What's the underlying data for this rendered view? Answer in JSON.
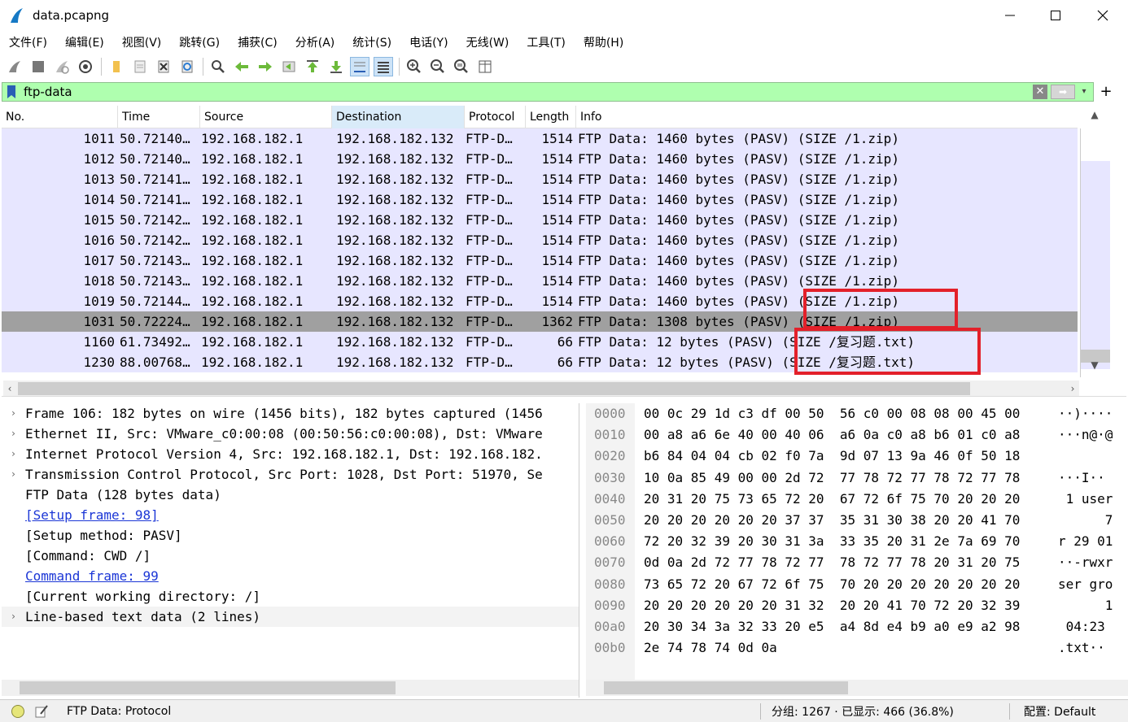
{
  "window": {
    "title": "data.pcapng",
    "controls": [
      "minimize",
      "maximize",
      "close"
    ]
  },
  "menu": [
    "文件(F)",
    "编辑(E)",
    "视图(V)",
    "跳转(G)",
    "捕获(C)",
    "分析(A)",
    "统计(S)",
    "电话(Y)",
    "无线(W)",
    "工具(T)",
    "帮助(H)"
  ],
  "toolbar": {
    "buttons": [
      "start-capture-icon",
      "stop-capture-icon",
      "restart-capture-icon",
      "capture-options-icon",
      "open-file-icon",
      "file-icon",
      "close-file-icon",
      "reload-icon",
      "find-packet-icon",
      "go-back-icon",
      "go-forward-icon",
      "go-to-packet-icon",
      "first-packet-icon",
      "last-packet-icon",
      "autoscroll-icon",
      "colorize-icon",
      "zoom-in-icon",
      "zoom-out-icon",
      "zoom-normal-icon",
      "resize-columns-icon"
    ]
  },
  "filter": {
    "value": "ftp-data",
    "bg_color": "#afffaf"
  },
  "packet_list": {
    "columns": [
      "No.",
      "Time",
      "Source",
      "Destination",
      "Protocol",
      "Length",
      "Info"
    ],
    "sorted_column": "Destination",
    "rows": [
      {
        "no": "1011",
        "time": "50.72140…",
        "src": "192.168.182.1",
        "dst": "192.168.182.132",
        "proto": "FTP-D…",
        "len": "1514",
        "info": "FTP Data: 1460 bytes (PASV) (SIZE /1.zip)",
        "selected": false
      },
      {
        "no": "1012",
        "time": "50.72140…",
        "src": "192.168.182.1",
        "dst": "192.168.182.132",
        "proto": "FTP-D…",
        "len": "1514",
        "info": "FTP Data: 1460 bytes (PASV) (SIZE /1.zip)",
        "selected": false
      },
      {
        "no": "1013",
        "time": "50.72141…",
        "src": "192.168.182.1",
        "dst": "192.168.182.132",
        "proto": "FTP-D…",
        "len": "1514",
        "info": "FTP Data: 1460 bytes (PASV) (SIZE /1.zip)",
        "selected": false
      },
      {
        "no": "1014",
        "time": "50.72141…",
        "src": "192.168.182.1",
        "dst": "192.168.182.132",
        "proto": "FTP-D…",
        "len": "1514",
        "info": "FTP Data: 1460 bytes (PASV) (SIZE /1.zip)",
        "selected": false
      },
      {
        "no": "1015",
        "time": "50.72142…",
        "src": "192.168.182.1",
        "dst": "192.168.182.132",
        "proto": "FTP-D…",
        "len": "1514",
        "info": "FTP Data: 1460 bytes (PASV) (SIZE /1.zip)",
        "selected": false
      },
      {
        "no": "1016",
        "time": "50.72142…",
        "src": "192.168.182.1",
        "dst": "192.168.182.132",
        "proto": "FTP-D…",
        "len": "1514",
        "info": "FTP Data: 1460 bytes (PASV) (SIZE /1.zip)",
        "selected": false
      },
      {
        "no": "1017",
        "time": "50.72143…",
        "src": "192.168.182.1",
        "dst": "192.168.182.132",
        "proto": "FTP-D…",
        "len": "1514",
        "info": "FTP Data: 1460 bytes (PASV) (SIZE /1.zip)",
        "selected": false
      },
      {
        "no": "1018",
        "time": "50.72143…",
        "src": "192.168.182.1",
        "dst": "192.168.182.132",
        "proto": "FTP-D…",
        "len": "1514",
        "info": "FTP Data: 1460 bytes (PASV) (SIZE /1.zip)",
        "selected": false
      },
      {
        "no": "1019",
        "time": "50.72144…",
        "src": "192.168.182.1",
        "dst": "192.168.182.132",
        "proto": "FTP-D…",
        "len": "1514",
        "info": "FTP Data: 1460 bytes (PASV) (SIZE /1.zip)",
        "selected": false
      },
      {
        "no": "1031",
        "time": "50.72224…",
        "src": "192.168.182.1",
        "dst": "192.168.182.132",
        "proto": "FTP-D…",
        "len": "1362",
        "info": "FTP Data: 1308 bytes (PASV) (SIZE /1.zip)",
        "selected": true
      },
      {
        "no": "1160",
        "time": "61.73492…",
        "src": "192.168.182.1",
        "dst": "192.168.182.132",
        "proto": "FTP-D…",
        "len": "66",
        "info": "FTP Data: 12 bytes (PASV) (SIZE /复习题.txt)",
        "selected": false
      },
      {
        "no": "1230",
        "time": "88.00768…",
        "src": "192.168.182.1",
        "dst": "192.168.182.132",
        "proto": "FTP-D…",
        "len": "66",
        "info": "FTP Data: 12 bytes (PASV) (SIZE /复习题.txt)",
        "selected": false
      }
    ]
  },
  "details": [
    {
      "text": "Frame 106: 182 bytes on wire (1456 bits), 182 bytes captured (1456",
      "expandable": true,
      "link": false
    },
    {
      "text": "Ethernet II, Src: VMware_c0:00:08 (00:50:56:c0:00:08), Dst: VMware",
      "expandable": true,
      "link": false
    },
    {
      "text": "Internet Protocol Version 4, Src: 192.168.182.1, Dst: 192.168.182.",
      "expandable": true,
      "link": false
    },
    {
      "text": "Transmission Control Protocol, Src Port: 1028, Dst Port: 51970, Se",
      "expandable": true,
      "link": false
    },
    {
      "text": "FTP Data (128 bytes data)",
      "expandable": false,
      "link": false
    },
    {
      "text": "[Setup frame: 98]",
      "expandable": false,
      "link": true
    },
    {
      "text": "[Setup method: PASV]",
      "expandable": false,
      "link": false
    },
    {
      "text": "[Command: CWD /]",
      "expandable": false,
      "link": false
    },
    {
      "text": "Command frame: 99",
      "expandable": false,
      "link": true
    },
    {
      "text": "[Current working directory: /]",
      "expandable": false,
      "link": false
    },
    {
      "text": "Line-based text data (2 lines)",
      "expandable": true,
      "link": false
    }
  ],
  "hex": [
    {
      "off": "0000",
      "bytes": "00 0c 29 1d c3 df 00 50  56 c0 00 08 08 00 45 00",
      "ascii": "··)····"
    },
    {
      "off": "0010",
      "bytes": "00 a8 a6 6e 40 00 40 06  a6 0a c0 a8 b6 01 c0 a8",
      "ascii": "···n@·@"
    },
    {
      "off": "0020",
      "bytes": "b6 84 04 04 cb 02 f0 7a  9d 07 13 9a 46 0f 50 18",
      "ascii": ""
    },
    {
      "off": "0030",
      "bytes": "10 0a 85 49 00 00 2d 72  77 78 72 77 78 72 77 78",
      "ascii": "···I··"
    },
    {
      "off": "0040",
      "bytes": "20 31 20 75 73 65 72 20  67 72 6f 75 70 20 20 20",
      "ascii": " 1 user"
    },
    {
      "off": "0050",
      "bytes": "20 20 20 20 20 20 37 37  35 31 30 38 20 20 41 70",
      "ascii": "      7"
    },
    {
      "off": "0060",
      "bytes": "72 20 32 39 20 30 31 3a  33 35 20 31 2e 7a 69 70",
      "ascii": "r 29 01"
    },
    {
      "off": "0070",
      "bytes": "0d 0a 2d 72 77 78 72 77  78 72 77 78 20 31 20 75",
      "ascii": "··-rwxr"
    },
    {
      "off": "0080",
      "bytes": "73 65 72 20 67 72 6f 75  70 20 20 20 20 20 20 20",
      "ascii": "ser gro"
    },
    {
      "off": "0090",
      "bytes": "20 20 20 20 20 20 31 32  20 20 41 70 72 20 32 39",
      "ascii": "      1"
    },
    {
      "off": "00a0",
      "bytes": "20 30 34 3a 32 33 20 e5  a4 8d e4 b9 a0 e9 a2 98",
      "ascii": " 04:23 "
    },
    {
      "off": "00b0",
      "bytes": "2e 74 78 74 0d 0a",
      "ascii": ".txt··"
    }
  ],
  "status": {
    "text": "FTP Data: Protocol",
    "stats": "分组: 1267 · 已显示: 466 (36.8%)",
    "profile": "配置: Default"
  }
}
